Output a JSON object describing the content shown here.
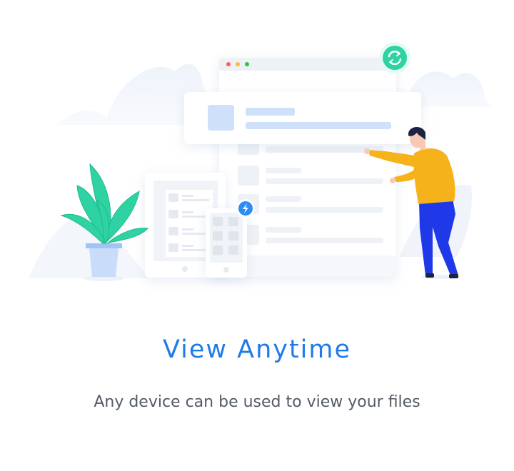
{
  "onboarding": {
    "title": "View Anytime",
    "subtitle": "Any device can be used to view your files"
  },
  "illustration": {
    "icons": [
      "sync-icon",
      "lightning-icon"
    ]
  },
  "colors": {
    "accent": "#1f7bea",
    "subtitle_text": "#555b66",
    "sync_badge": "#2fd3a3",
    "lightning_badge": "#2b8cf5",
    "plant_leaf": "#2fd3a3",
    "person_shirt": "#f6b21a",
    "person_pants": "#2039e8",
    "window_red": "#ff5f57",
    "window_yellow": "#febc2e",
    "window_green": "#28c840"
  }
}
